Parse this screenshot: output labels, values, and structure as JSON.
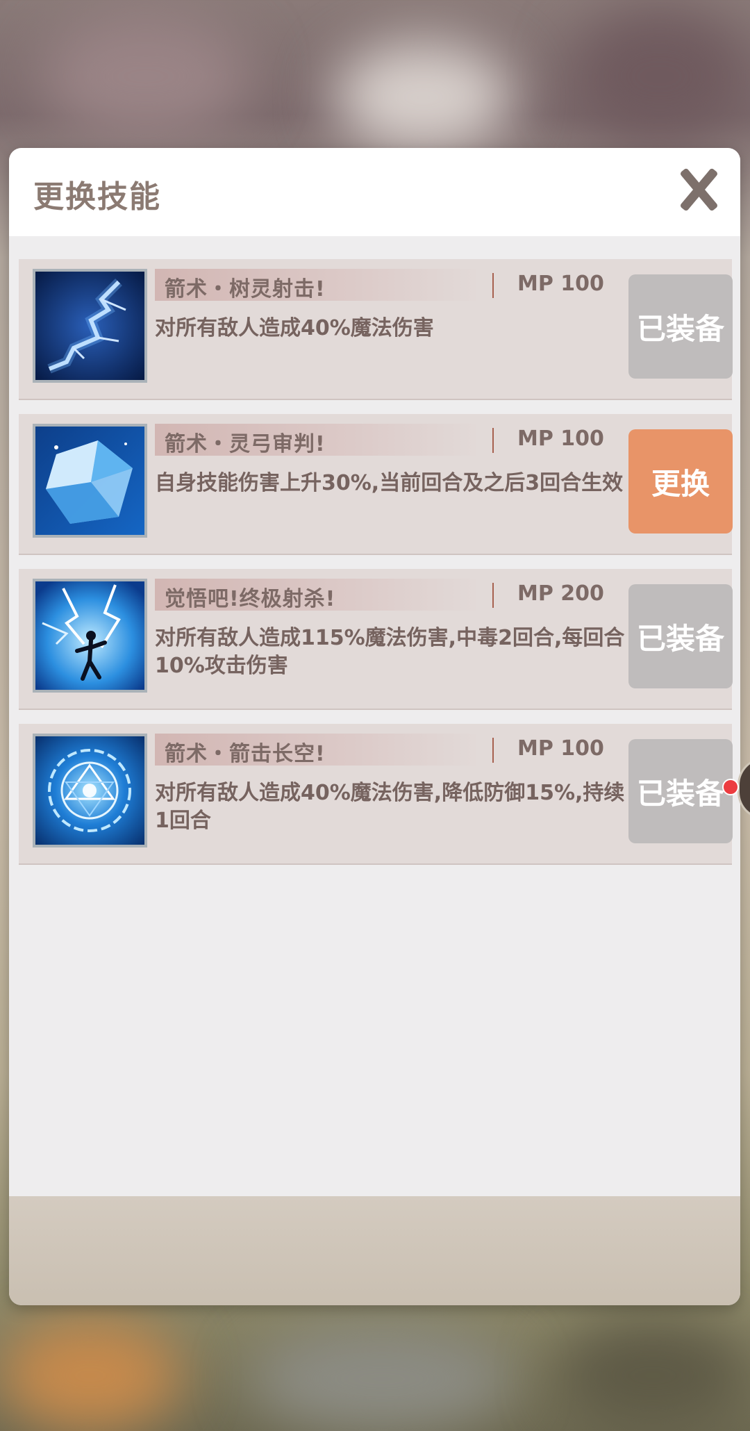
{
  "dialog": {
    "title": "更换技能"
  },
  "skills": [
    {
      "name": "箭术・树灵射击!",
      "mp": "MP 100",
      "description": "对所有敌人造成40%魔法伤害",
      "action_label": "已装备",
      "action_state": "equipped",
      "icon": "lightning-bolt-icon"
    },
    {
      "name": "箭术・灵弓审判!",
      "mp": "MP 100",
      "description": "自身技能伤害上升30%,当前回合及之后3回合生效",
      "action_label": "更换",
      "action_state": "replace",
      "icon": "ice-crystal-icon"
    },
    {
      "name": "觉悟吧!终极射杀!",
      "mp": "MP 200",
      "description": "对所有敌人造成115%魔法伤害,中毒2回合,每回合10%攻击伤害",
      "action_label": "已装备",
      "action_state": "equipped",
      "icon": "lightning-figure-icon"
    },
    {
      "name": "箭术・箭击长空!",
      "mp": "MP 100",
      "description": "对所有敌人造成40%魔法伤害,降低防御15%,持续1回合",
      "action_label": "已装备",
      "action_state": "equipped",
      "icon": "rune-circle-icon"
    }
  ],
  "colors": {
    "equipped_button": "#bfbcbc",
    "replace_button": "#e89468",
    "title_text": "#8b7a72"
  }
}
